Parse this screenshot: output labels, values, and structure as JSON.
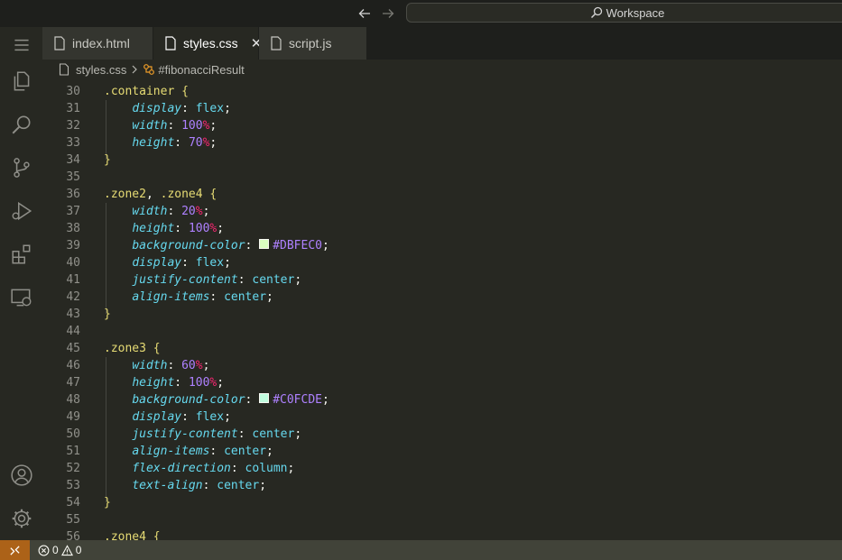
{
  "titlebar": {
    "search_label": "Workspace",
    "back_icon": "arrow-left-icon",
    "forward_icon": "arrow-right-icon"
  },
  "activity_bar": {
    "items": [
      "menu-icon",
      "explorer-icon",
      "search-icon",
      "source-control-icon",
      "run-debug-icon",
      "extensions-icon",
      "remote-explorer-icon",
      "accounts-icon",
      "settings-gear-icon"
    ]
  },
  "tabs": [
    {
      "label": "index.html",
      "active": false
    },
    {
      "label": "styles.css",
      "active": true,
      "close": "✕"
    },
    {
      "label": "script.js",
      "active": false
    }
  ],
  "breadcrumb": {
    "file": "styles.css",
    "symbol": "#fibonacciResult"
  },
  "editor": {
    "lines": [
      {
        "n": "30",
        "tokens": [
          [
            "sel",
            ".container "
          ],
          [
            "brace",
            "{"
          ]
        ]
      },
      {
        "n": "31",
        "tokens": [
          [
            "prop",
            "display"
          ],
          [
            "p",
            ": "
          ],
          [
            "val",
            "flex"
          ],
          [
            "p",
            ";"
          ]
        ]
      },
      {
        "n": "32",
        "tokens": [
          [
            "prop",
            "width"
          ],
          [
            "p",
            ": "
          ],
          [
            "num",
            "100"
          ],
          [
            "unit",
            "%"
          ],
          [
            "p",
            ";"
          ]
        ]
      },
      {
        "n": "33",
        "tokens": [
          [
            "prop",
            "height"
          ],
          [
            "p",
            ": "
          ],
          [
            "num",
            "70"
          ],
          [
            "unit",
            "%"
          ],
          [
            "p",
            ";"
          ]
        ]
      },
      {
        "n": "34",
        "tokens": [
          [
            "brace",
            "}"
          ]
        ]
      },
      {
        "n": "35",
        "tokens": []
      },
      {
        "n": "36",
        "tokens": [
          [
            "sel",
            ".zone2"
          ],
          [
            "p",
            ", "
          ],
          [
            "sel",
            ".zone4 "
          ],
          [
            "brace",
            "{"
          ]
        ]
      },
      {
        "n": "37",
        "tokens": [
          [
            "prop",
            "width"
          ],
          [
            "p",
            ": "
          ],
          [
            "num",
            "20"
          ],
          [
            "unit",
            "%"
          ],
          [
            "p",
            ";"
          ]
        ]
      },
      {
        "n": "38",
        "tokens": [
          [
            "prop",
            "height"
          ],
          [
            "p",
            ": "
          ],
          [
            "num",
            "100"
          ],
          [
            "unit",
            "%"
          ],
          [
            "p",
            ";"
          ]
        ]
      },
      {
        "n": "39",
        "tokens": [
          [
            "prop",
            "background-color"
          ],
          [
            "p",
            ": "
          ],
          [
            "swatch",
            "#DBFEC0"
          ],
          [
            "hex",
            "#DBFEC0"
          ],
          [
            "p",
            ";"
          ]
        ]
      },
      {
        "n": "40",
        "tokens": [
          [
            "prop",
            "display"
          ],
          [
            "p",
            ": "
          ],
          [
            "val",
            "flex"
          ],
          [
            "p",
            ";"
          ]
        ]
      },
      {
        "n": "41",
        "tokens": [
          [
            "prop",
            "justify-content"
          ],
          [
            "p",
            ": "
          ],
          [
            "val",
            "center"
          ],
          [
            "p",
            ";"
          ]
        ]
      },
      {
        "n": "42",
        "tokens": [
          [
            "prop",
            "align-items"
          ],
          [
            "p",
            ": "
          ],
          [
            "val",
            "center"
          ],
          [
            "p",
            ";"
          ]
        ]
      },
      {
        "n": "43",
        "tokens": [
          [
            "brace",
            "}"
          ]
        ]
      },
      {
        "n": "44",
        "tokens": []
      },
      {
        "n": "45",
        "tokens": [
          [
            "sel",
            ".zone3 "
          ],
          [
            "brace",
            "{"
          ]
        ]
      },
      {
        "n": "46",
        "tokens": [
          [
            "prop",
            "width"
          ],
          [
            "p",
            ": "
          ],
          [
            "num",
            "60"
          ],
          [
            "unit",
            "%"
          ],
          [
            "p",
            ";"
          ]
        ]
      },
      {
        "n": "47",
        "tokens": [
          [
            "prop",
            "height"
          ],
          [
            "p",
            ": "
          ],
          [
            "num",
            "100"
          ],
          [
            "unit",
            "%"
          ],
          [
            "p",
            ";"
          ]
        ]
      },
      {
        "n": "48",
        "tokens": [
          [
            "prop",
            "background-color"
          ],
          [
            "p",
            ": "
          ],
          [
            "swatch",
            "#C0FCDE"
          ],
          [
            "hex",
            "#C0FCDE"
          ],
          [
            "p",
            ";"
          ]
        ]
      },
      {
        "n": "49",
        "tokens": [
          [
            "prop",
            "display"
          ],
          [
            "p",
            ": "
          ],
          [
            "val",
            "flex"
          ],
          [
            "p",
            ";"
          ]
        ]
      },
      {
        "n": "50",
        "tokens": [
          [
            "prop",
            "justify-content"
          ],
          [
            "p",
            ": "
          ],
          [
            "val",
            "center"
          ],
          [
            "p",
            ";"
          ]
        ]
      },
      {
        "n": "51",
        "tokens": [
          [
            "prop",
            "align-items"
          ],
          [
            "p",
            ": "
          ],
          [
            "val",
            "center"
          ],
          [
            "p",
            ";"
          ]
        ]
      },
      {
        "n": "52",
        "tokens": [
          [
            "prop",
            "flex-direction"
          ],
          [
            "p",
            ": "
          ],
          [
            "val",
            "column"
          ],
          [
            "p",
            ";"
          ]
        ]
      },
      {
        "n": "53",
        "tokens": [
          [
            "prop",
            "text-align"
          ],
          [
            "p",
            ": "
          ],
          [
            "val",
            "center"
          ],
          [
            "p",
            ";"
          ]
        ]
      },
      {
        "n": "54",
        "tokens": [
          [
            "brace",
            "}"
          ]
        ]
      },
      {
        "n": "55",
        "tokens": []
      },
      {
        "n": "56",
        "tokens": [
          [
            "sel",
            ".zone4 "
          ],
          [
            "brace",
            "{"
          ]
        ]
      }
    ]
  },
  "statusbar": {
    "errors": "0",
    "warnings": "0"
  },
  "colors": {
    "background": "#272822",
    "remote": "#ac6218"
  }
}
